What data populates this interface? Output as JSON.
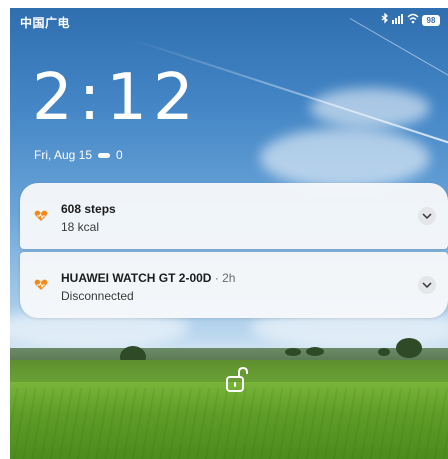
{
  "status_bar": {
    "carrier": "中国广电",
    "battery": "98"
  },
  "lockscreen": {
    "time": "2:12",
    "date": "Fri, Aug 15",
    "temperature": "0"
  },
  "notifications": [
    {
      "title": "608 steps",
      "meta": "",
      "text": "18 kcal",
      "icon": "huawei-health-icon"
    },
    {
      "title": "HUAWEI WATCH GT 2-00D",
      "meta": " · 2h",
      "text": "Disconnected",
      "icon": "huawei-health-icon"
    }
  ],
  "icons": {
    "status": [
      "bluetooth-icon",
      "signal-icon",
      "wifi-icon",
      "battery-icon"
    ],
    "unlock": "unlock-icon",
    "expand": "chevron-down-icon"
  },
  "colors": {
    "health_accent": "#f28a1c",
    "card_bg": "#f6f8fa"
  }
}
